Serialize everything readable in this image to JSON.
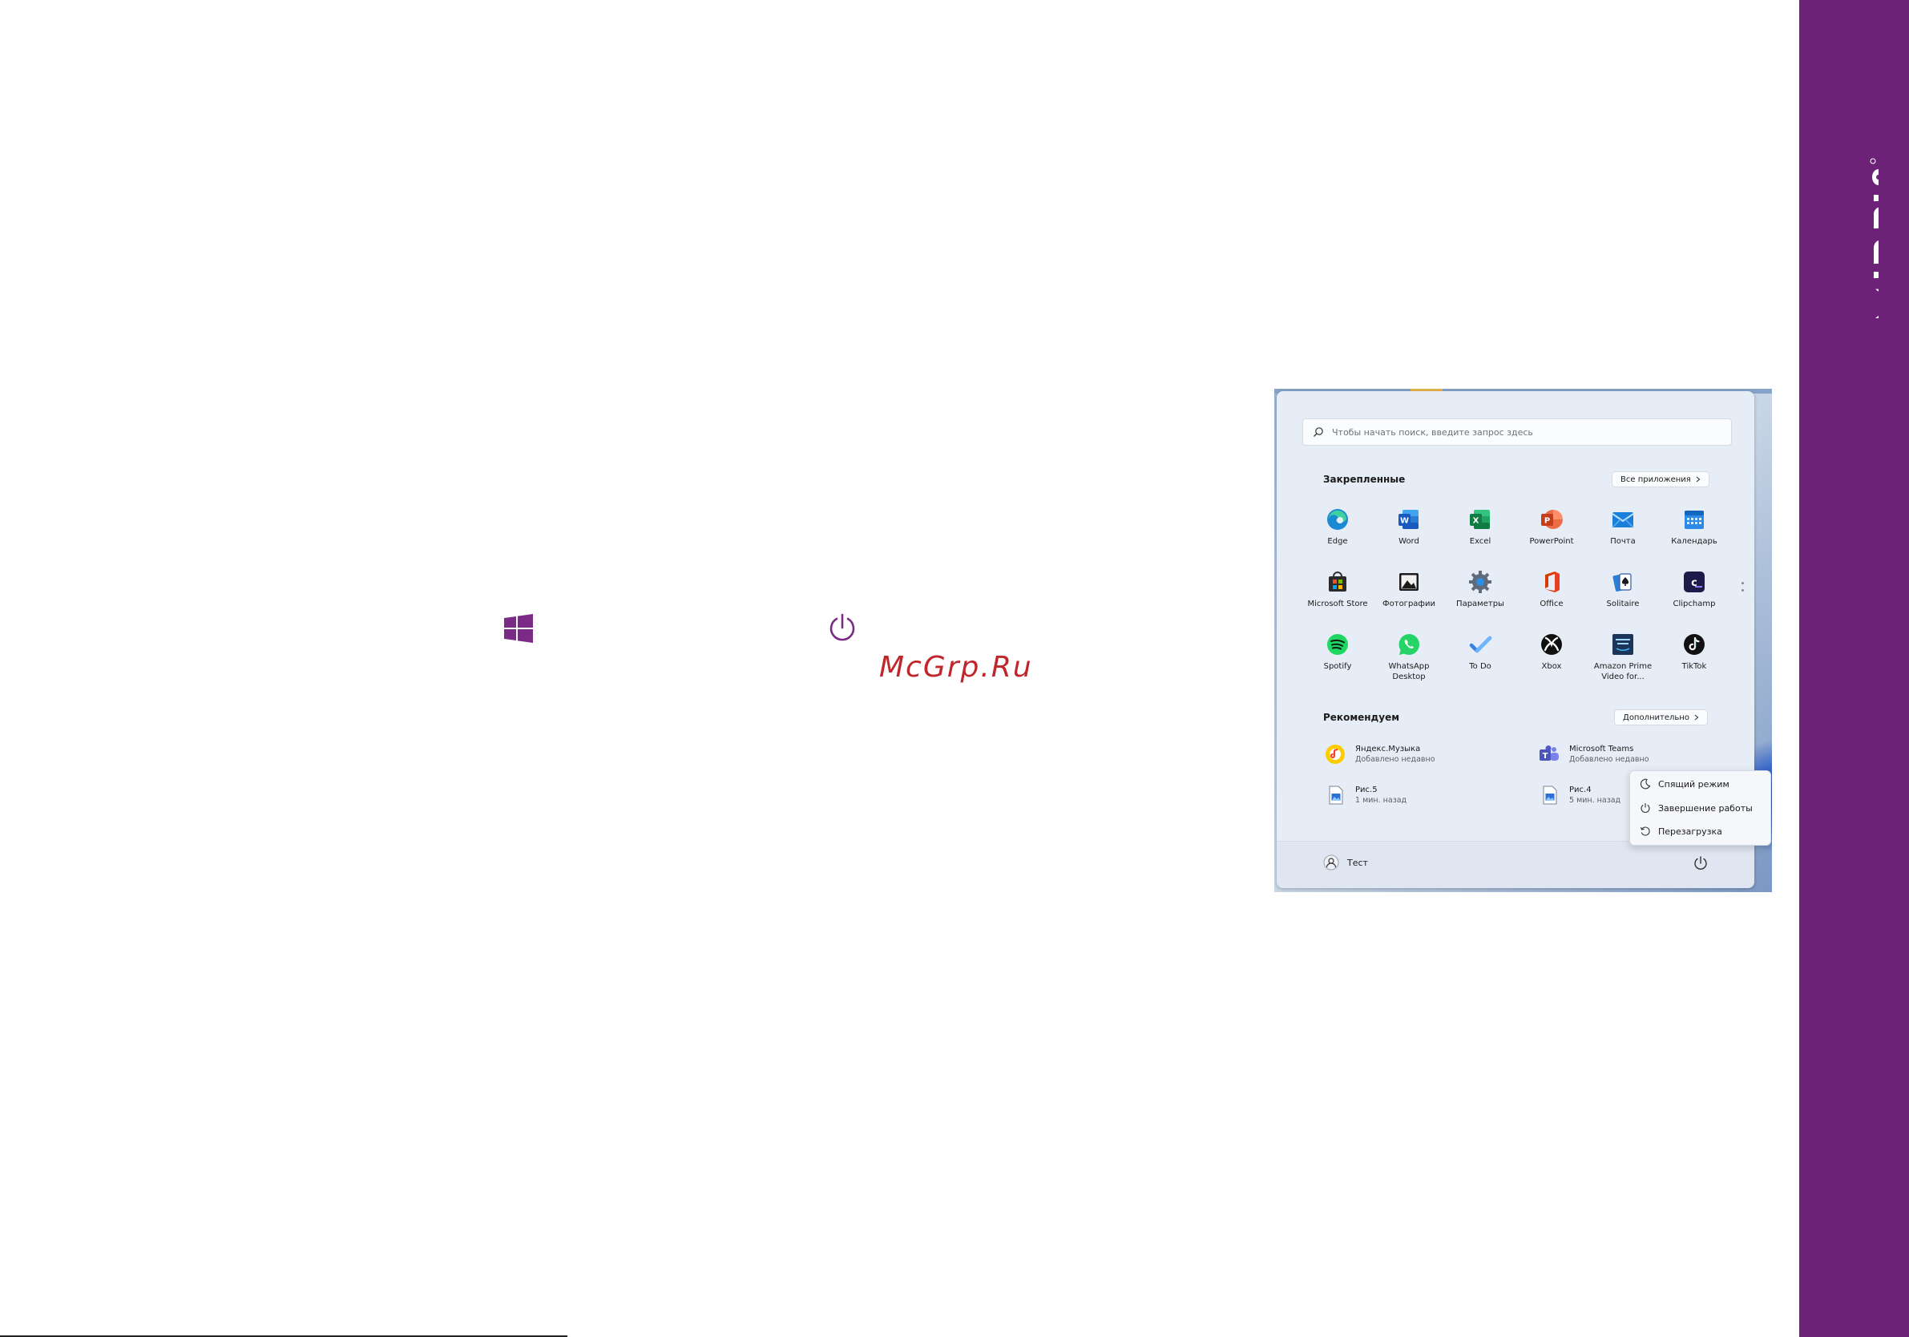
{
  "brand": {
    "name": "IRBIS",
    "color": "#6c2377"
  },
  "page": {
    "watermark": "McGrp.Ru",
    "accent": "#7b2a85"
  },
  "start_menu": {
    "search": {
      "placeholder": "Чтобы начать поиск, введите запрос здесь"
    },
    "pinned": {
      "title": "Закрепленные",
      "all_apps_label": "Все приложения",
      "apps": [
        {
          "label": "Edge",
          "icon": "edge-icon"
        },
        {
          "label": "Word",
          "icon": "word-icon"
        },
        {
          "label": "Excel",
          "icon": "excel-icon"
        },
        {
          "label": "PowerPoint",
          "icon": "powerpoint-icon"
        },
        {
          "label": "Почта",
          "icon": "mail-icon"
        },
        {
          "label": "Календарь",
          "icon": "calendar-icon"
        },
        {
          "label": "Microsoft Store",
          "icon": "store-icon"
        },
        {
          "label": "Фотографии",
          "icon": "photos-icon"
        },
        {
          "label": "Параметры",
          "icon": "settings-icon"
        },
        {
          "label": "Office",
          "icon": "office-icon"
        },
        {
          "label": "Solitaire",
          "icon": "solitaire-icon"
        },
        {
          "label": "Clipchamp",
          "icon": "clipchamp-icon"
        },
        {
          "label": "Spotify",
          "icon": "spotify-icon"
        },
        {
          "label": "WhatsApp Desktop",
          "icon": "whatsapp-icon"
        },
        {
          "label": "To Do",
          "icon": "todo-icon"
        },
        {
          "label": "Xbox",
          "icon": "xbox-icon"
        },
        {
          "label": "Amazon Prime Video for...",
          "icon": "prime-video-icon"
        },
        {
          "label": "TikTok",
          "icon": "tiktok-icon"
        }
      ]
    },
    "recommended": {
      "title": "Рекомендуем",
      "more_label": "Дополнительно",
      "items": [
        {
          "title": "Яндекс.Музыка",
          "subtitle": "Добавлено недавно",
          "icon": "yandex-music-icon"
        },
        {
          "title": "Microsoft Teams",
          "subtitle": "Добавлено недавно",
          "icon": "teams-icon"
        },
        {
          "title": "Рис.5",
          "subtitle": "1 мин. назад",
          "icon": "image-file-icon"
        },
        {
          "title": "Рис.4",
          "subtitle": "5 мин. назад",
          "icon": "image-file-icon"
        }
      ]
    },
    "user": {
      "name": "Тест"
    },
    "power_menu": {
      "items": [
        {
          "label": "Спящий режим",
          "icon": "sleep-icon"
        },
        {
          "label": "Завершение работы",
          "icon": "shutdown-icon"
        },
        {
          "label": "Перезагрузка",
          "icon": "restart-icon"
        }
      ]
    }
  }
}
